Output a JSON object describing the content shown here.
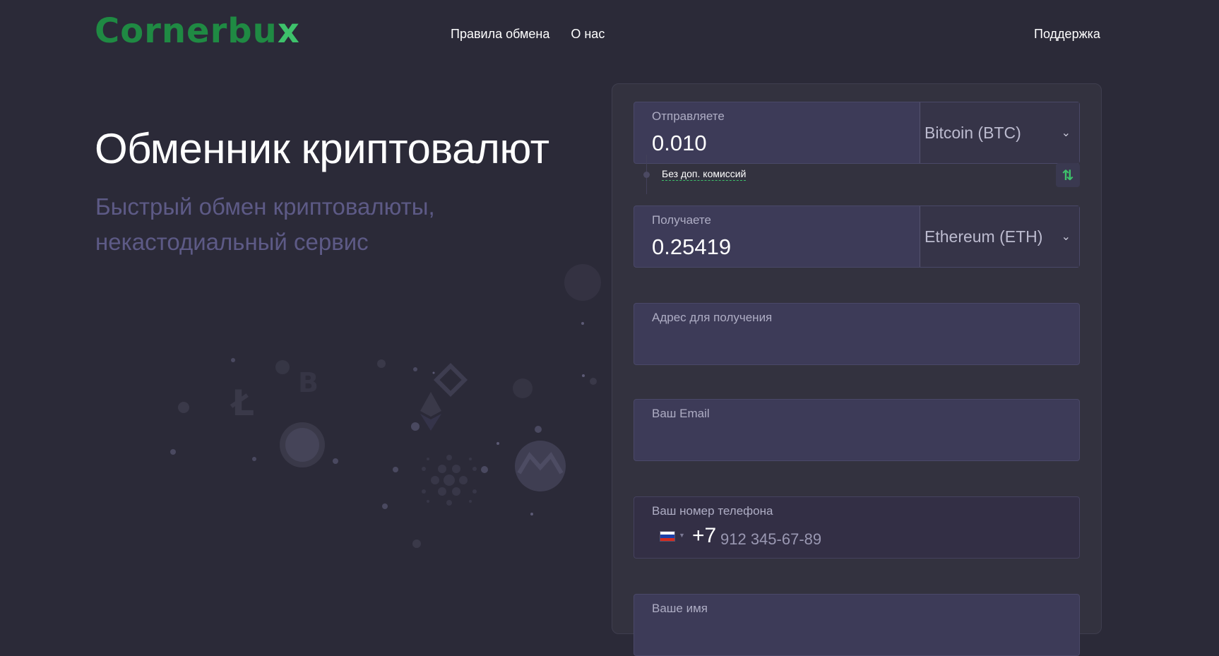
{
  "header": {
    "logo_main": "Cornerbu",
    "logo_x": "x",
    "nav": [
      "Правила обмена",
      "О нас"
    ],
    "support": "Поддержка"
  },
  "hero": {
    "title": "Обменник криптовалют",
    "subtitle": "Быстрый обмен криптовалюты, некастодиальный сервис"
  },
  "form": {
    "send": {
      "label": "Отправляете",
      "value": "0.010",
      "currency": "Bitcoin (BTC)"
    },
    "commission": "Без доп. комиссий",
    "receive": {
      "label": "Получаете",
      "value": "0.25419",
      "currency": "Ethereum (ETH)"
    },
    "address": {
      "label": "Адрес для получения"
    },
    "email": {
      "label": "Ваш Email"
    },
    "phone": {
      "label": "Ваш номер телефона",
      "code": "+7",
      "placeholder": "912 345-67-89"
    },
    "name": {
      "label": "Ваше имя"
    }
  },
  "icons": [
    "chevron-down-icon",
    "swap-arrows-icon",
    "russia-flag-icon",
    "bitcoin-icon",
    "litecoin-icon",
    "ethereum-icon",
    "monero-icon",
    "dogecoin-icon",
    "binance-icon",
    "cardano-icon"
  ],
  "colors": {
    "background": "#2b2a38",
    "accent_green": "#3ec26b",
    "logo_green": "#1f8a43",
    "field_bg": "#3d3b58",
    "subtitle": "#5d5a86"
  }
}
